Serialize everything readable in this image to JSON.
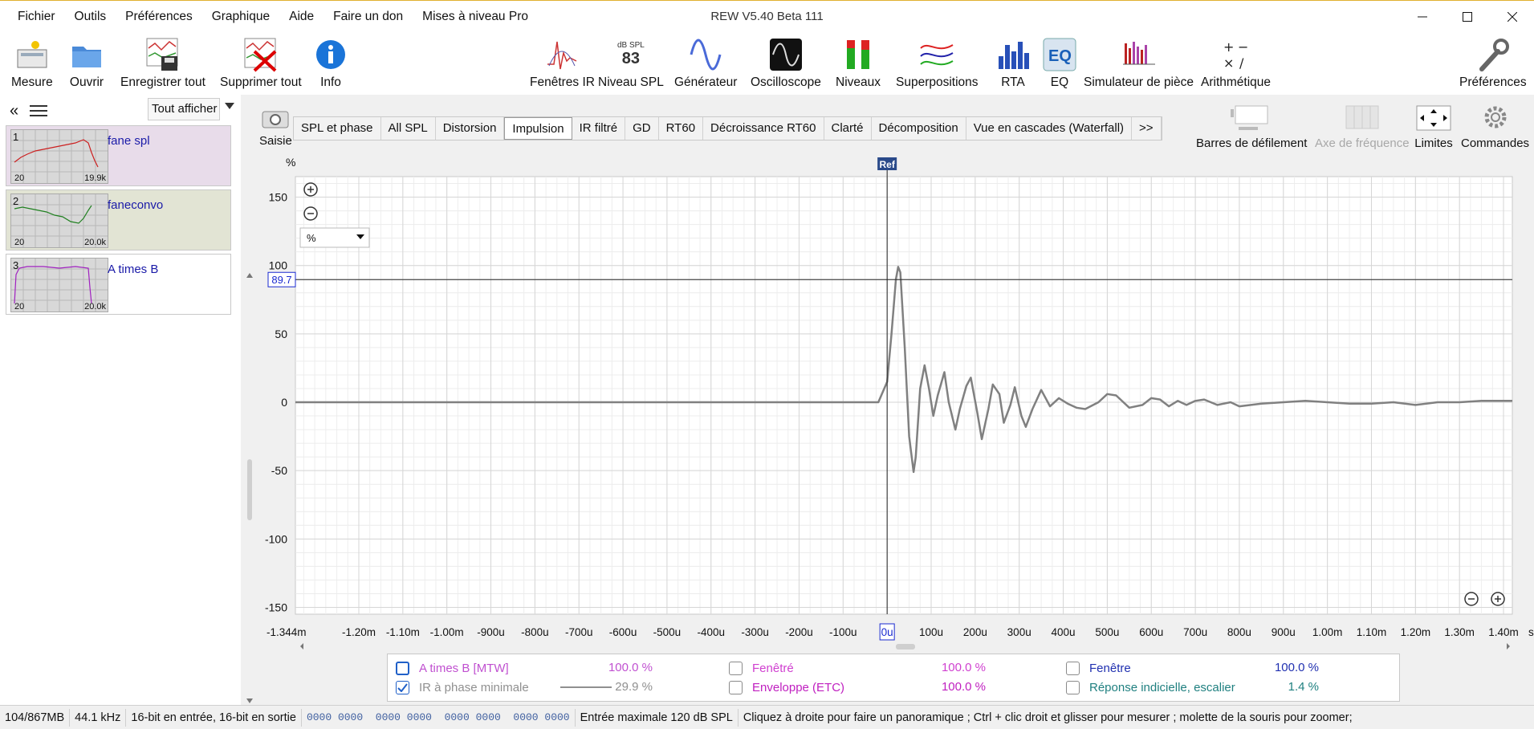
{
  "app": {
    "title": "REW V5.40 Beta 111",
    "menu": [
      "Fichier",
      "Outils",
      "Préférences",
      "Graphique",
      "Aide",
      "Faire un don",
      "Mises à niveau Pro"
    ]
  },
  "toolbar": {
    "left": [
      {
        "label": "Mesure",
        "icon": "measure-icon"
      },
      {
        "label": "Ouvrir",
        "icon": "folder-icon"
      },
      {
        "label": "Enregistrer tout",
        "icon": "save-all-icon"
      },
      {
        "label": "Supprimer tout",
        "icon": "delete-all-icon"
      },
      {
        "label": "Info",
        "icon": "info-icon"
      }
    ],
    "center": [
      {
        "label": "Fenêtres IR",
        "icon": "ir-windows-icon"
      },
      {
        "label": "Niveau SPL",
        "icon": "spl-meter-icon",
        "badge_unit": "dB SPL",
        "badge_value": "83"
      },
      {
        "label": "Générateur",
        "icon": "generator-icon"
      },
      {
        "label": "Oscilloscope",
        "icon": "oscilloscope-icon"
      },
      {
        "label": "Niveaux",
        "icon": "levels-icon"
      },
      {
        "label": "Superpositions",
        "icon": "overlays-icon"
      },
      {
        "label": "RTA",
        "icon": "rta-icon"
      },
      {
        "label": "EQ",
        "icon": "eq-icon"
      },
      {
        "label": "Simulateur de pièce",
        "icon": "room-sim-icon"
      },
      {
        "label": "Arithmétique",
        "icon": "arithmetic-icon"
      }
    ],
    "right": {
      "label": "Préférences",
      "icon": "wrench-icon"
    }
  },
  "left_panel": {
    "show_all": "Tout afficher",
    "measurements": [
      {
        "num": "1",
        "name": "fane spl",
        "lo": "20",
        "hi": "19.9k",
        "bg": "#e8dcea",
        "trace": "#cc2020"
      },
      {
        "num": "2",
        "name": "faneconvo",
        "lo": "20",
        "hi": "20.0k",
        "bg": "#e2e4d4",
        "trace": "#208020"
      },
      {
        "num": "3",
        "name": "A times B",
        "lo": "20",
        "hi": "20.0k",
        "bg": "#ffffff",
        "trace": "#a020c0"
      }
    ]
  },
  "graph": {
    "capture_label": "Saisie",
    "tabs": [
      "SPL et phase",
      "All SPL",
      "Distorsion",
      "Impulsion",
      "IR filtré",
      "GD",
      "RT60",
      "Décroissance RT60",
      "Clarté",
      "Décomposition",
      "Vue en cascades (Waterfall)",
      ">>"
    ],
    "active_tab": "Impulsion",
    "right_buttons": [
      {
        "label": "Barres de défilement",
        "enabled": true
      },
      {
        "label": "Axe de fréquence",
        "enabled": false
      },
      {
        "label": "Limites",
        "enabled": true
      },
      {
        "label": "Commandes",
        "enabled": true
      }
    ],
    "unit_label": "%",
    "unit_select": "%",
    "ref_label": "Ref",
    "cursor_value": "89.7",
    "cursor_x_value": "0u",
    "s_label": "s"
  },
  "chart_data": {
    "type": "line",
    "ylabel": "%",
    "ylim": [
      -155,
      165
    ],
    "xlim": [
      -1.344,
      1.42
    ],
    "x_unit": "ms",
    "y_ticks": [
      150,
      100,
      50,
      0,
      -50,
      -100,
      -150
    ],
    "x_tick_labels": [
      "-1.344m",
      "-1.20m",
      "-1.10m",
      "-1.00m",
      "-900u",
      "-800u",
      "-700u",
      "-600u",
      "-500u",
      "-400u",
      "-300u",
      "-200u",
      "-100u",
      "0u",
      "100u",
      "200u",
      "300u",
      "400u",
      "500u",
      "600u",
      "700u",
      "800u",
      "900u",
      "1.00m",
      "1.10m",
      "1.20m",
      "1.30m",
      "1.40m"
    ],
    "x_tick_values": [
      -1.344,
      -1.2,
      -1.1,
      -1.0,
      -0.9,
      -0.8,
      -0.7,
      -0.6,
      -0.5,
      -0.4,
      -0.3,
      -0.2,
      -0.1,
      0,
      0.1,
      0.2,
      0.3,
      0.4,
      0.5,
      0.6,
      0.7,
      0.8,
      0.9,
      1.0,
      1.1,
      1.2,
      1.3,
      1.4
    ],
    "cursor_y": 89.7,
    "ref_x": 0,
    "series": [
      {
        "color": "#808080",
        "x": [
          -1.344,
          -0.02,
          0.0,
          0.01,
          0.02,
          0.025,
          0.03,
          0.04,
          0.05,
          0.06,
          0.065,
          0.075,
          0.085,
          0.095,
          0.105,
          0.115,
          0.13,
          0.14,
          0.155,
          0.165,
          0.18,
          0.19,
          0.205,
          0.215,
          0.23,
          0.24,
          0.255,
          0.265,
          0.28,
          0.29,
          0.305,
          0.315,
          0.33,
          0.35,
          0.37,
          0.39,
          0.41,
          0.43,
          0.45,
          0.48,
          0.5,
          0.52,
          0.55,
          0.58,
          0.6,
          0.62,
          0.64,
          0.66,
          0.68,
          0.7,
          0.72,
          0.75,
          0.78,
          0.8,
          0.85,
          0.9,
          0.95,
          1.0,
          1.05,
          1.1,
          1.15,
          1.2,
          1.25,
          1.3,
          1.35,
          1.42
        ],
        "y": [
          0,
          0,
          15,
          50,
          90,
          99,
          95,
          40,
          -25,
          -51,
          -40,
          10,
          27,
          10,
          -10,
          5,
          22,
          0,
          -20,
          -5,
          12,
          18,
          -8,
          -27,
          -5,
          13,
          6,
          -15,
          -2,
          11,
          -10,
          -18,
          -5,
          9,
          -3,
          3,
          -1,
          -4,
          -5,
          0,
          6,
          5,
          -4,
          -2,
          3,
          2,
          -3,
          1,
          -2,
          1,
          2,
          -2,
          0,
          -3,
          -1,
          0,
          1,
          0,
          -1,
          -1,
          0,
          -2,
          0,
          0,
          1,
          1
        ]
      }
    ]
  },
  "legend": {
    "items": [
      {
        "label": "A times B [MTW]",
        "value": "100.0 %",
        "color": "#c050d0",
        "checked": false,
        "highlight": true
      },
      {
        "label": "IR à phase minimale",
        "value": "29.9 %",
        "color": "#909090",
        "checked": true
      },
      {
        "label": "Fenêtré",
        "value": "100.0 %",
        "color": "#d040d0",
        "checked": false
      },
      {
        "label": "Enveloppe (ETC)",
        "value": "100.0 %",
        "color": "#c020c0",
        "checked": false
      },
      {
        "label": "Fenêtre",
        "value": "100.0 %",
        "color": "#2030b0",
        "checked": false
      },
      {
        "label": "Réponse indicielle, escalier",
        "value": "1.4 %",
        "color": "#208080",
        "checked": false
      }
    ]
  },
  "status": {
    "memory": "104/867MB",
    "rate": "44.1 kHz",
    "bits": "16-bit en entrée, 16-bit en sortie",
    "levels": "0000 0000  0000 0000  0000 0000  0000 0000",
    "max_input": "Entrée maximale 120 dB SPL",
    "hint": "Cliquez à droite pour faire un panoramique ; Ctrl + clic droit et glisser pour mesurer ; molette de la souris pour zoomer;"
  }
}
